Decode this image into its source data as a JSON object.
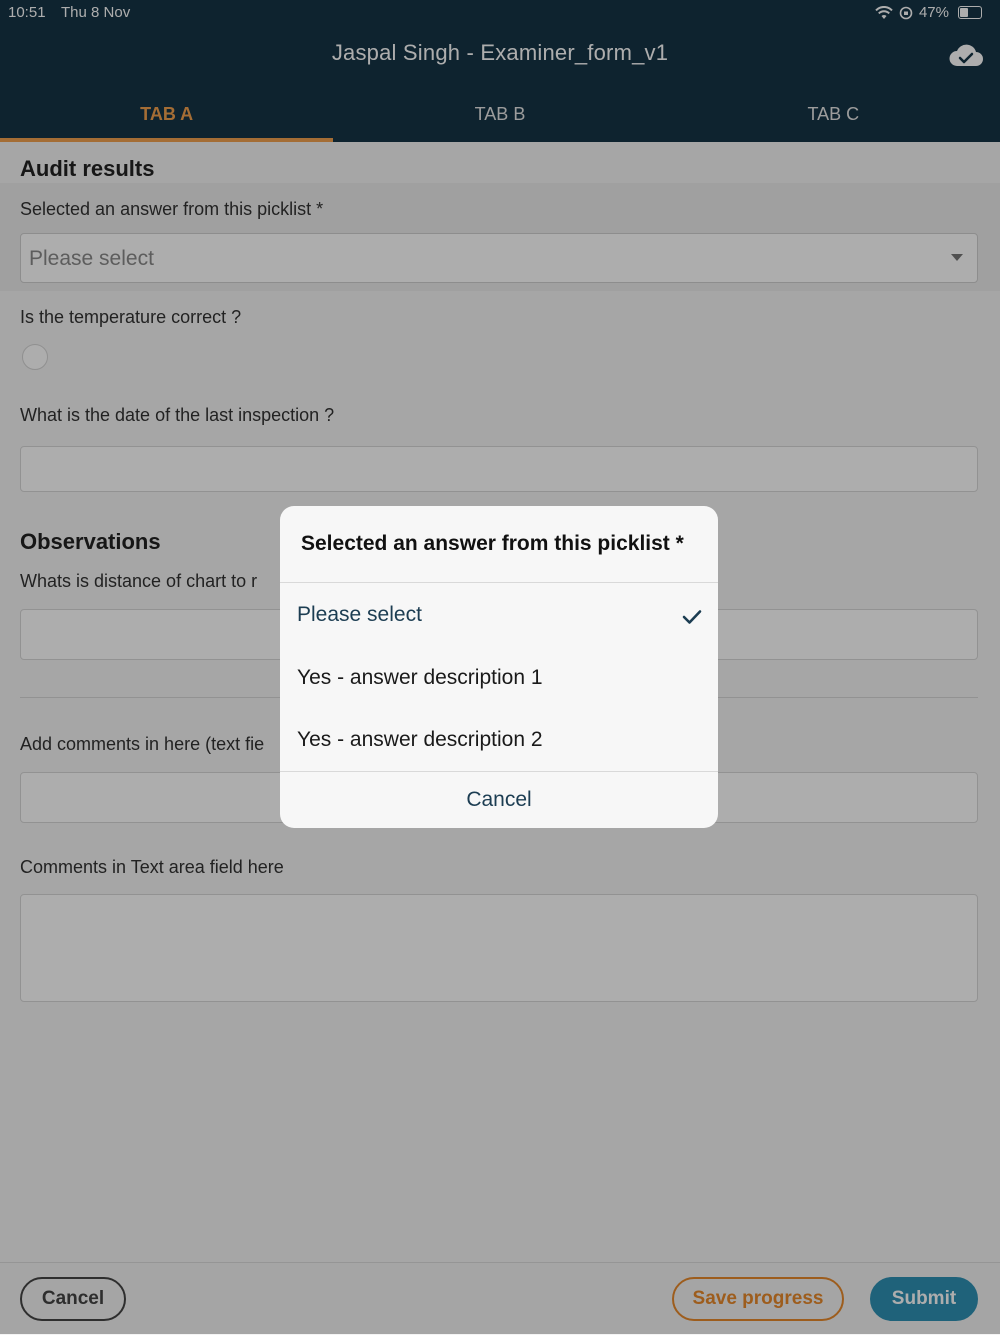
{
  "status_bar": {
    "time": "10:51",
    "date": "Thu 8 Nov",
    "battery": "47%",
    "battery_level": 0.47
  },
  "header": {
    "title": "Jaspal Singh - Examiner_form_v1",
    "sync_icon": "cloud-check-icon"
  },
  "tabs": [
    {
      "label": "TAB A",
      "active": true
    },
    {
      "label": "TAB B",
      "active": false
    },
    {
      "label": "TAB C",
      "active": false
    }
  ],
  "form": {
    "audit_title": "Audit results",
    "picklist_label": "Selected an answer from this picklist *",
    "picklist_value": "Please select",
    "temperature_label": "Is the temperature correct ?",
    "inspection_label": "What is the date of the last inspection ?",
    "inspection_value": "",
    "observations_title": "Observations",
    "distance_label": "Whats is distance of chart to r",
    "distance_value": "",
    "comments_label": "Add comments in here (text fie",
    "comments_value": "",
    "textarea_label": "Comments in Text area field here",
    "textarea_value": ""
  },
  "footer": {
    "cancel_label": "Cancel",
    "save_label": "Save progress",
    "submit_label": "Submit"
  },
  "dialog": {
    "title": "Selected an answer from this picklist *",
    "options": [
      {
        "label": "Please select",
        "selected": true
      },
      {
        "label": "Yes - answer description 1",
        "selected": false
      },
      {
        "label": "Yes - answer description 2",
        "selected": false
      }
    ],
    "cancel_label": "Cancel"
  },
  "colors": {
    "header_bg": "#153446",
    "accent_orange": "#f2a14f",
    "submit_blue": "#2f91b4",
    "dialog_text": "#1c3d52"
  }
}
